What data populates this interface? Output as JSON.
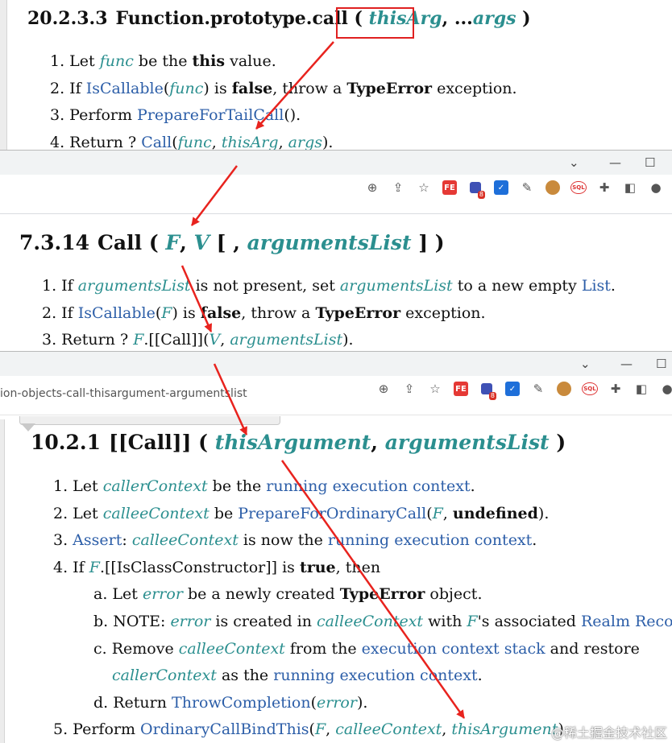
{
  "section1": {
    "number": "20.2.3.3",
    "name": "Function.prototype.call",
    "open": "(",
    "param1": "thisArg",
    "sep": ", ...",
    "param2": "args",
    "close": ")",
    "steps": [
      {
        "num": "1.",
        "parts": [
          {
            "t": "Let "
          },
          {
            "t": "func",
            "c": "var"
          },
          {
            "t": " be the "
          },
          {
            "t": "this",
            "c": "b"
          },
          {
            "t": " value."
          }
        ]
      },
      {
        "num": "2.",
        "parts": [
          {
            "t": "If "
          },
          {
            "t": "IsCallable",
            "c": "link"
          },
          {
            "t": "("
          },
          {
            "t": "func",
            "c": "var"
          },
          {
            "t": ") is "
          },
          {
            "t": "false",
            "c": "b"
          },
          {
            "t": ", throw a "
          },
          {
            "t": "TypeError",
            "c": "b"
          },
          {
            "t": " exception."
          }
        ]
      },
      {
        "num": "3.",
        "parts": [
          {
            "t": "Perform "
          },
          {
            "t": "PrepareForTailCall",
            "c": "link"
          },
          {
            "t": "()."
          }
        ]
      },
      {
        "num": "4.",
        "parts": [
          {
            "t": "Return ? "
          },
          {
            "t": "Call",
            "c": "link"
          },
          {
            "t": "("
          },
          {
            "t": "func",
            "c": "var"
          },
          {
            "t": ", "
          },
          {
            "t": "thisArg",
            "c": "var"
          },
          {
            "t": ", "
          },
          {
            "t": "args",
            "c": "var"
          },
          {
            "t": ")."
          }
        ]
      }
    ]
  },
  "section2": {
    "number": "7.3.14",
    "name": "Call",
    "open": "(",
    "param1": "F",
    "sep1": ", ",
    "param2": "V",
    "bracket": " [ , ",
    "param3": "argumentsList",
    "close": " ] )",
    "steps": [
      {
        "num": "1.",
        "parts": [
          {
            "t": "If "
          },
          {
            "t": "argumentsList",
            "c": "var"
          },
          {
            "t": " is not present, set "
          },
          {
            "t": "argumentsList",
            "c": "var"
          },
          {
            "t": " to a new empty "
          },
          {
            "t": "List",
            "c": "link"
          },
          {
            "t": "."
          }
        ]
      },
      {
        "num": "2.",
        "parts": [
          {
            "t": "If "
          },
          {
            "t": "IsCallable",
            "c": "link"
          },
          {
            "t": "("
          },
          {
            "t": "F",
            "c": "var"
          },
          {
            "t": ") is "
          },
          {
            "t": "false",
            "c": "b"
          },
          {
            "t": ", throw a "
          },
          {
            "t": "TypeError",
            "c": "b"
          },
          {
            "t": " exception."
          }
        ]
      },
      {
        "num": "3.",
        "parts": [
          {
            "t": "Return ? "
          },
          {
            "t": "F",
            "c": "var"
          },
          {
            "t": ".[[Call]]("
          },
          {
            "t": "V",
            "c": "var"
          },
          {
            "t": ", "
          },
          {
            "t": "argumentsList",
            "c": "var"
          },
          {
            "t": ")."
          }
        ]
      }
    ]
  },
  "section3": {
    "number": "10.2.1",
    "name": "[[Call]]",
    "open": "(",
    "param1": "thisArgument",
    "sep": ", ",
    "param2": "argumentsList",
    "close": ")",
    "steps": [
      {
        "num": "1.",
        "indent": 0,
        "parts": [
          {
            "t": "Let "
          },
          {
            "t": "callerContext",
            "c": "var"
          },
          {
            "t": " be the "
          },
          {
            "t": "running execution context",
            "c": "link"
          },
          {
            "t": "."
          }
        ]
      },
      {
        "num": "2.",
        "indent": 0,
        "parts": [
          {
            "t": "Let "
          },
          {
            "t": "calleeContext",
            "c": "var"
          },
          {
            "t": " be "
          },
          {
            "t": "PrepareForOrdinaryCall",
            "c": "link"
          },
          {
            "t": "("
          },
          {
            "t": "F",
            "c": "var"
          },
          {
            "t": ", "
          },
          {
            "t": "undefined",
            "c": "b"
          },
          {
            "t": ")."
          }
        ]
      },
      {
        "num": "3.",
        "indent": 0,
        "parts": [
          {
            "t": "Assert",
            "c": "link"
          },
          {
            "t": ": "
          },
          {
            "t": "calleeContext",
            "c": "var"
          },
          {
            "t": " is now the "
          },
          {
            "t": "running execution context",
            "c": "link"
          },
          {
            "t": "."
          }
        ]
      },
      {
        "num": "4.",
        "indent": 0,
        "parts": [
          {
            "t": "If "
          },
          {
            "t": "F",
            "c": "var"
          },
          {
            "t": ".[[IsClassConstructor]] is "
          },
          {
            "t": "true",
            "c": "b"
          },
          {
            "t": ", then"
          }
        ]
      },
      {
        "num": "a.",
        "indent": 1,
        "parts": [
          {
            "t": "Let "
          },
          {
            "t": "error",
            "c": "var"
          },
          {
            "t": " be a newly created "
          },
          {
            "t": "TypeError",
            "c": "b"
          },
          {
            "t": " object."
          }
        ]
      },
      {
        "num": "b.",
        "indent": 1,
        "parts": [
          {
            "t": "NOTE: "
          },
          {
            "t": "error",
            "c": "var"
          },
          {
            "t": " is created in "
          },
          {
            "t": "calleeContext",
            "c": "var"
          },
          {
            "t": " with "
          },
          {
            "t": "F",
            "c": "var"
          },
          {
            "t": "'s associated "
          },
          {
            "t": "Realm Record",
            "c": "link"
          },
          {
            "t": "."
          }
        ]
      },
      {
        "num": "c.",
        "indent": 1,
        "parts": [
          {
            "t": "Remove "
          },
          {
            "t": "calleeContext",
            "c": "var"
          },
          {
            "t": " from the "
          },
          {
            "t": "execution context stack",
            "c": "link"
          },
          {
            "t": " and restore"
          }
        ]
      },
      {
        "num": "",
        "indent": 1,
        "parts": [
          {
            "t": "callerContext",
            "c": "var"
          },
          {
            "t": " as the "
          },
          {
            "t": "running execution context",
            "c": "link"
          },
          {
            "t": "."
          }
        ]
      },
      {
        "num": "d.",
        "indent": 1,
        "parts": [
          {
            "t": "Return "
          },
          {
            "t": "ThrowCompletion",
            "c": "link"
          },
          {
            "t": "("
          },
          {
            "t": "error",
            "c": "var"
          },
          {
            "t": ")."
          }
        ]
      },
      {
        "num": "5.",
        "indent": 0,
        "parts": [
          {
            "t": "Perform "
          },
          {
            "t": "OrdinaryCallBindThis",
            "c": "link"
          },
          {
            "t": "("
          },
          {
            "t": "F",
            "c": "var"
          },
          {
            "t": ", "
          },
          {
            "t": "calleeContext",
            "c": "var"
          },
          {
            "t": ", "
          },
          {
            "t": "thisArgument",
            "c": "var"
          },
          {
            "t": ")."
          }
        ]
      }
    ]
  },
  "browser2": {
    "minimize": "—",
    "maximize": "☐",
    "chevron": "⌄",
    "badge": "8",
    "ext1": "FE",
    "ext_sql": "SQL"
  },
  "browser3": {
    "url": "ion-objects-call-thisargument-argumentslist",
    "minimize": "—",
    "maximize": "☐",
    "chevron": "⌄",
    "badge": "8",
    "ext1": "FE",
    "ext_sql": "SQL"
  },
  "watermark": "@稀土掘金技术社区",
  "colors": {
    "param": "#2b8f8f",
    "link": "#2c5ea8",
    "arrow": "#e8231e"
  }
}
